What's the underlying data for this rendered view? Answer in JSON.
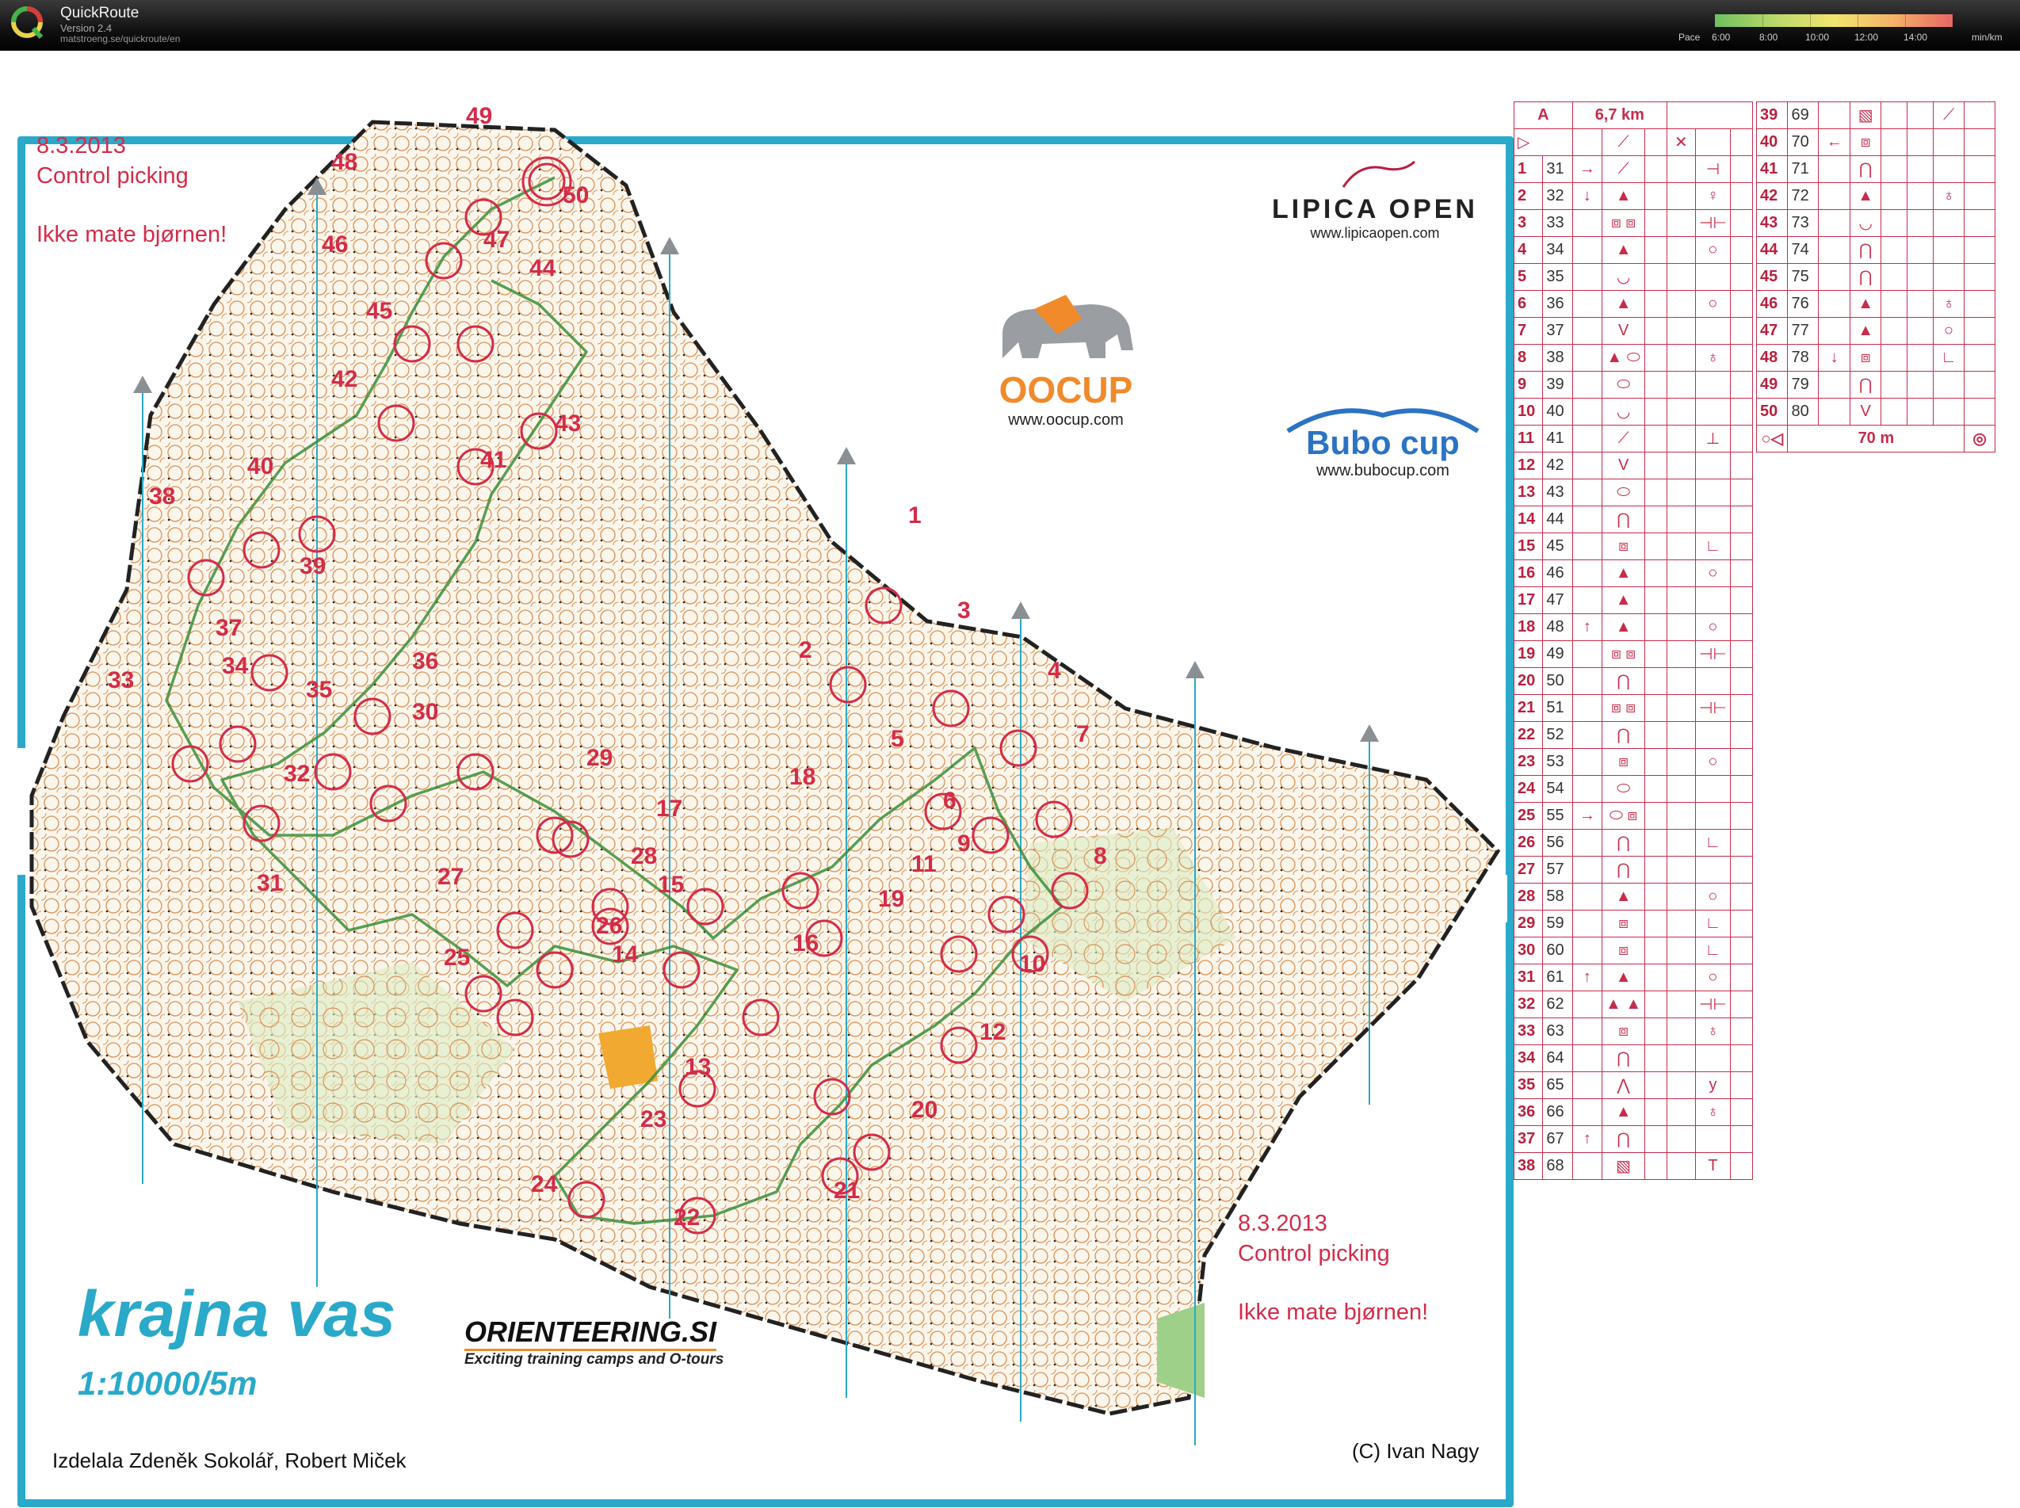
{
  "app": {
    "title": "QuickRoute",
    "version": "Version 2.4",
    "url": "matstroeng.se/quickroute/en"
  },
  "pace_legend": {
    "label": "Pace",
    "ticks": [
      "6:00",
      "8:00",
      "10:00",
      "12:00",
      "14:00"
    ],
    "unit": "min/km",
    "colors": [
      "#6fbf5f",
      "#b9d86a",
      "#f2e56e",
      "#f5b268",
      "#e86666"
    ]
  },
  "map": {
    "event_top": {
      "date": "8.3.2013",
      "course": "Control picking",
      "note": "Ikke mate bjørnen!"
    },
    "event_bottom": {
      "date": "8.3.2013",
      "course": "Control picking",
      "note": "Ikke mate bjørnen!"
    },
    "name": "krajna vas",
    "scale": "1:10000/5m",
    "author": "Izdelala Zdeněk Sokolář, Robert Miček",
    "copyright": "(C) Ivan Nagy",
    "frame_color": "#2aa9c9",
    "route_color": "#3a8f3a",
    "control_color": "#d42c4a",
    "controls": [
      "1",
      "2",
      "3",
      "4",
      "5",
      "6",
      "7",
      "8",
      "9",
      "10",
      "11",
      "12",
      "13",
      "14",
      "15",
      "16",
      "17",
      "18",
      "19",
      "20",
      "21",
      "22",
      "23",
      "24",
      "25",
      "26",
      "27",
      "28",
      "29",
      "30",
      "31",
      "32",
      "33",
      "34",
      "35",
      "36",
      "37",
      "38",
      "39",
      "40",
      "41",
      "42",
      "43",
      "44",
      "45",
      "46",
      "47",
      "48",
      "49",
      "50"
    ]
  },
  "sponsors": {
    "lipica": {
      "name": "LIPICA OPEN",
      "url": "www.lipicaopen.com"
    },
    "oocup": {
      "name": "OOCUP",
      "url": "www.oocup.com"
    },
    "bubo": {
      "name": "Bubo cup",
      "url": "www.bubocup.com"
    },
    "orienteering": {
      "name": "ORIENTEERING.SI",
      "tagline": "Exciting training camps and O-tours"
    }
  },
  "descriptions": {
    "course": "A",
    "length": "6,7 km",
    "finish_distance": "70 m",
    "rows": [
      {
        "n": "1",
        "code": "31",
        "c": "→",
        "d": "⟋",
        "g": "⊣"
      },
      {
        "n": "2",
        "code": "32",
        "c": "↓",
        "d": "▲",
        "g": "♀"
      },
      {
        "n": "3",
        "code": "33",
        "c": "",
        "d": "⧈ ⧈",
        "g": "⊣⊢"
      },
      {
        "n": "4",
        "code": "34",
        "c": "",
        "d": "▲",
        "g": "○"
      },
      {
        "n": "5",
        "code": "35",
        "c": "",
        "d": "◡",
        "g": ""
      },
      {
        "n": "6",
        "code": "36",
        "c": "",
        "d": "▲",
        "g": "○"
      },
      {
        "n": "7",
        "code": "37",
        "c": "",
        "d": "V",
        "g": ""
      },
      {
        "n": "8",
        "code": "38",
        "c": "",
        "d": "▲ ⬭",
        "g": "♁"
      },
      {
        "n": "9",
        "code": "39",
        "c": "",
        "d": "⬭",
        "g": ""
      },
      {
        "n": "10",
        "code": "40",
        "c": "",
        "d": "◡",
        "g": ""
      },
      {
        "n": "11",
        "code": "41",
        "c": "",
        "d": "⟋",
        "g": "⊥"
      },
      {
        "n": "12",
        "code": "42",
        "c": "",
        "d": "V",
        "g": ""
      },
      {
        "n": "13",
        "code": "43",
        "c": "",
        "d": "⬭",
        "g": ""
      },
      {
        "n": "14",
        "code": "44",
        "c": "",
        "d": "⋂",
        "g": ""
      },
      {
        "n": "15",
        "code": "45",
        "c": "",
        "d": "⧈",
        "g": "∟"
      },
      {
        "n": "16",
        "code": "46",
        "c": "",
        "d": "▲",
        "g": "○"
      },
      {
        "n": "17",
        "code": "47",
        "c": "",
        "d": "▲",
        "g": ""
      },
      {
        "n": "18",
        "code": "48",
        "c": "↑",
        "d": "▲",
        "g": "○"
      },
      {
        "n": "19",
        "code": "49",
        "c": "",
        "d": "⧈ ⧈",
        "g": "⊣⊢"
      },
      {
        "n": "20",
        "code": "50",
        "c": "",
        "d": "⋂",
        "g": ""
      },
      {
        "n": "21",
        "code": "51",
        "c": "",
        "d": "⧈ ⧈",
        "g": "⊣⊢"
      },
      {
        "n": "22",
        "code": "52",
        "c": "",
        "d": "⋂",
        "g": ""
      },
      {
        "n": "23",
        "code": "53",
        "c": "",
        "d": "⧈",
        "g": "○"
      },
      {
        "n": "24",
        "code": "54",
        "c": "",
        "d": "⬭",
        "g": ""
      },
      {
        "n": "25",
        "code": "55",
        "c": "→",
        "d": "⬭ ⧈",
        "g": ""
      },
      {
        "n": "26",
        "code": "56",
        "c": "",
        "d": "⋂",
        "g": "∟"
      },
      {
        "n": "27",
        "code": "57",
        "c": "",
        "d": "⋂",
        "g": ""
      },
      {
        "n": "28",
        "code": "58",
        "c": "",
        "d": "▲",
        "g": "○"
      },
      {
        "n": "29",
        "code": "59",
        "c": "",
        "d": "⧈",
        "g": "∟"
      },
      {
        "n": "30",
        "code": "60",
        "c": "",
        "d": "⧈",
        "g": "∟"
      },
      {
        "n": "31",
        "code": "61",
        "c": "↑",
        "d": "▲",
        "g": "○"
      },
      {
        "n": "32",
        "code": "62",
        "c": "",
        "d": "▲ ▲",
        "g": "⊣⊢"
      },
      {
        "n": "33",
        "code": "63",
        "c": "",
        "d": "⧈",
        "g": "♁"
      },
      {
        "n": "34",
        "code": "64",
        "c": "",
        "d": "⋂",
        "g": ""
      },
      {
        "n": "35",
        "code": "65",
        "c": "",
        "d": "⋀",
        "g": "y"
      },
      {
        "n": "36",
        "code": "66",
        "c": "",
        "d": "▲",
        "g": "♁"
      },
      {
        "n": "37",
        "code": "67",
        "c": "↑",
        "d": "⋂",
        "g": ""
      },
      {
        "n": "38",
        "code": "68",
        "c": "",
        "d": "▧",
        "g": "T"
      }
    ],
    "rows2": [
      {
        "n": "39",
        "code": "69",
        "c": "",
        "d": "▧",
        "g": "⟋"
      },
      {
        "n": "40",
        "code": "70",
        "c": "←",
        "d": "⧈",
        "g": ""
      },
      {
        "n": "41",
        "code": "71",
        "c": "",
        "d": "⋂",
        "g": ""
      },
      {
        "n": "42",
        "code": "72",
        "c": "",
        "d": "▲",
        "g": "♁"
      },
      {
        "n": "43",
        "code": "73",
        "c": "",
        "d": "◡",
        "g": ""
      },
      {
        "n": "44",
        "code": "74",
        "c": "",
        "d": "⋂",
        "g": ""
      },
      {
        "n": "45",
        "code": "75",
        "c": "",
        "d": "⋂",
        "g": ""
      },
      {
        "n": "46",
        "code": "76",
        "c": "",
        "d": "▲",
        "g": "♁"
      },
      {
        "n": "47",
        "code": "77",
        "c": "",
        "d": "▲",
        "g": "○"
      },
      {
        "n": "48",
        "code": "78",
        "c": "↓",
        "d": "⧈",
        "g": "∟"
      },
      {
        "n": "49",
        "code": "79",
        "c": "",
        "d": "⋂",
        "g": ""
      },
      {
        "n": "50",
        "code": "80",
        "c": "",
        "d": "V",
        "g": ""
      }
    ]
  }
}
